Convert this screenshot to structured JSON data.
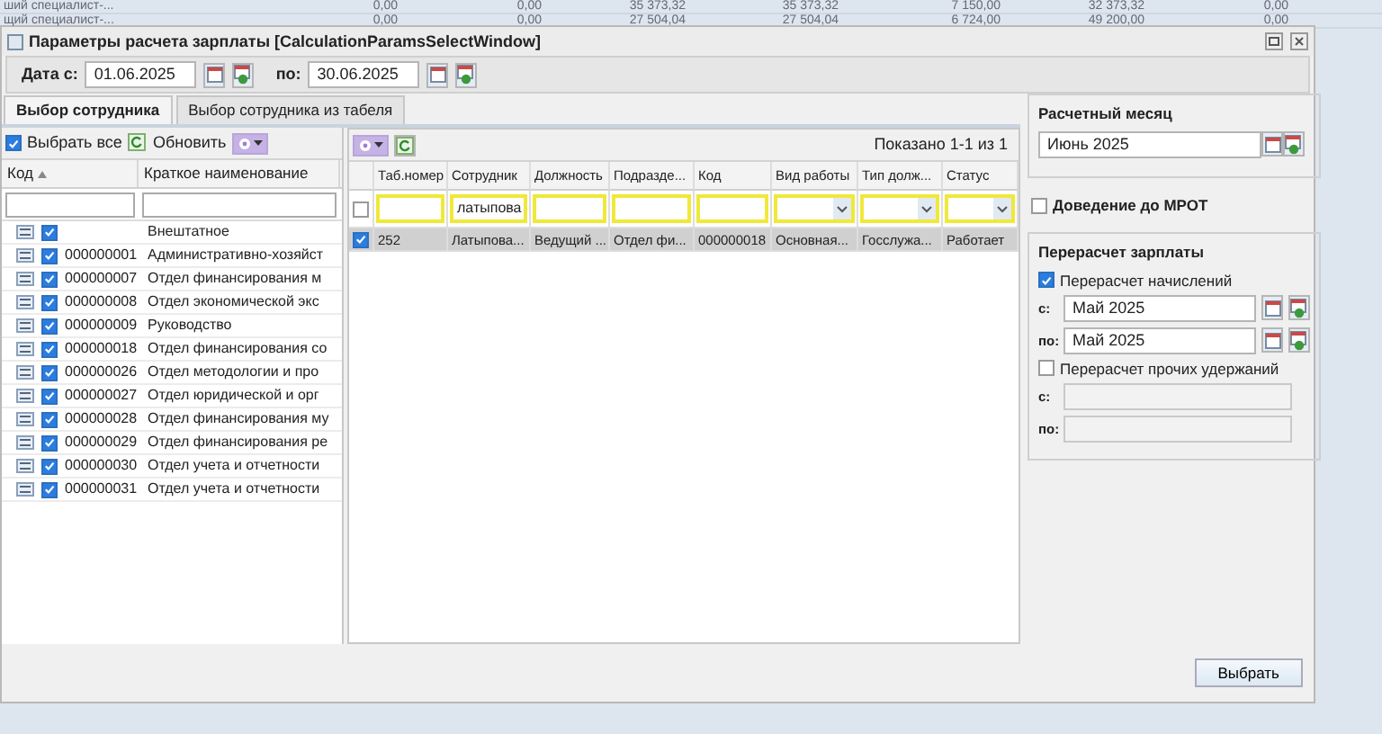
{
  "background_grid": {
    "rows": [
      {
        "cells": [
          "ший специалист-...",
          "0,00",
          "0,00",
          "35 373,32",
          "35 373,32",
          "7 150,00",
          "32 373,32",
          "0,00"
        ]
      },
      {
        "cells": [
          "щий специалист-...",
          "0,00",
          "0,00",
          "27 504,04",
          "27 504,04",
          "6 724,00",
          "49 200,00",
          "0,00"
        ]
      }
    ]
  },
  "window": {
    "title": "Параметры расчета зарплаты [CalculationParamsSelectWindow]"
  },
  "date_range": {
    "from_label": "Дата с:",
    "from_value": "01.06.2025",
    "to_label": "по:",
    "to_value": "30.06.2025"
  },
  "tabs": [
    {
      "label": "Выбор сотрудника",
      "selected": true
    },
    {
      "label": "Выбор сотрудника из табеля",
      "selected": false
    }
  ],
  "departments": {
    "select_all": {
      "label": "Выбрать все",
      "checked": true
    },
    "refresh_label": "Обновить",
    "columns": [
      "Код",
      "Краткое наименование"
    ],
    "rows": [
      {
        "name": "Внештатное",
        "checked": true
      },
      {
        "code": "000000001",
        "name": "Административно-хозяйст",
        "checked": true
      },
      {
        "code": "000000007",
        "name": "Отдел финансирования м",
        "checked": true
      },
      {
        "code": "000000008",
        "name": "Отдел экономической экс",
        "checked": true
      },
      {
        "code": "000000009",
        "name": "Руководство",
        "checked": true
      },
      {
        "code": "000000018",
        "name": "Отдел финансирования со",
        "checked": true
      },
      {
        "code": "000000026",
        "name": "Отдел методологии и про",
        "checked": true
      },
      {
        "code": "000000027",
        "name": "Отдел юридической и орг",
        "checked": true
      },
      {
        "code": "000000028",
        "name": "Отдел финансирования му",
        "checked": true
      },
      {
        "code": "000000029",
        "name": "Отдел финансирования ре",
        "checked": true
      },
      {
        "code": "000000030",
        "name": "Отдел учета и отчетности",
        "checked": true
      },
      {
        "code": "000000031",
        "name": "Отдел учета и отчетности",
        "checked": true
      }
    ]
  },
  "employees": {
    "shown": "Показано 1-1 из 1",
    "header_checked": false,
    "columns": [
      "Таб.номер",
      "Сотрудник",
      "Должность",
      "Подразде...",
      "Код",
      "Вид работы",
      "Тип долж...",
      "Статус"
    ],
    "filters": [
      {
        "kind": "text"
      },
      {
        "kind": "text",
        "value": "латыпова"
      },
      {
        "kind": "text"
      },
      {
        "kind": "text"
      },
      {
        "kind": "text"
      },
      {
        "kind": "select"
      },
      {
        "kind": "select"
      },
      {
        "kind": "select"
      }
    ],
    "rows": [
      {
        "selected": true,
        "checked": true,
        "cells": [
          "252",
          "Латыпова...",
          "Ведущий ...",
          "Отдел фи...",
          "000000018",
          "Основная...",
          "Госслужа...",
          "Работает"
        ]
      }
    ]
  },
  "month": {
    "title": "Расчетный месяц",
    "value": "Июнь 2025"
  },
  "mrot": {
    "label": "Доведение до МРОТ",
    "checked": false
  },
  "recalc": {
    "title": "Перерасчет зарплаты",
    "accruals": {
      "label": "Перерасчет начислений",
      "checked": true,
      "from_label": "с:",
      "from_value": "Май 2025",
      "to_label": "по:",
      "to_value": "Май 2025"
    },
    "deductions": {
      "label": "Перерасчет прочих удержаний",
      "checked": false,
      "from_label": "с:",
      "to_label": "по:"
    }
  },
  "buttons": [
    {
      "label": "Выбрать"
    }
  ]
}
